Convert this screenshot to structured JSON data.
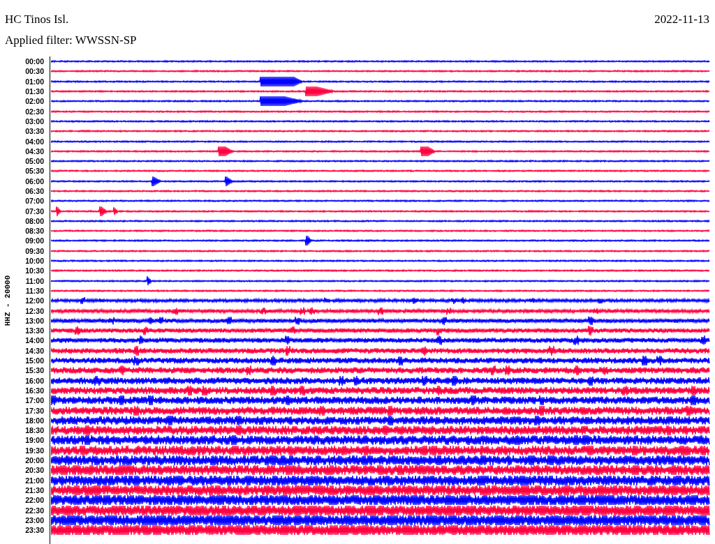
{
  "station": "HC Tinos Isl.",
  "date": "2022-11-13",
  "filter": "Applied filter: WWSSN-SP",
  "axis_label": "HHZ - 20000",
  "rows": [
    {
      "time": "00:00",
      "color": "#0000ff"
    },
    {
      "time": "00:30",
      "color": "#ff0040"
    },
    {
      "time": "01:00",
      "color": "#0000ff"
    },
    {
      "time": "01:30",
      "color": "#ff0040"
    },
    {
      "time": "02:00",
      "color": "#0000ff"
    },
    {
      "time": "02:30",
      "color": "#ff0040"
    },
    {
      "time": "03:00",
      "color": "#0000ff"
    },
    {
      "time": "03:30",
      "color": "#ff0040"
    },
    {
      "time": "04:00",
      "color": "#0000ff"
    },
    {
      "time": "04:30",
      "color": "#ff0040"
    },
    {
      "time": "05:00",
      "color": "#0000ff"
    },
    {
      "time": "05:30",
      "color": "#ff0040"
    },
    {
      "time": "06:00",
      "color": "#0000ff"
    },
    {
      "time": "06:30",
      "color": "#ff0040"
    },
    {
      "time": "07:00",
      "color": "#0000ff"
    },
    {
      "time": "07:30",
      "color": "#ff0040"
    },
    {
      "time": "08:00",
      "color": "#0000ff"
    },
    {
      "time": "08:30",
      "color": "#ff0040"
    },
    {
      "time": "09:00",
      "color": "#0000ff"
    },
    {
      "time": "09:30",
      "color": "#ff0040"
    },
    {
      "time": "10:00",
      "color": "#0000ff"
    },
    {
      "time": "10:30",
      "color": "#ff0040"
    },
    {
      "time": "11:00",
      "color": "#0000ff"
    },
    {
      "time": "11:30",
      "color": "#ff0040"
    },
    {
      "time": "12:00",
      "color": "#0000ff"
    },
    {
      "time": "12:30",
      "color": "#ff0040"
    },
    {
      "time": "13:00",
      "color": "#0000ff"
    },
    {
      "time": "13:30",
      "color": "#ff0040"
    },
    {
      "time": "14:00",
      "color": "#0000ff"
    },
    {
      "time": "14:30",
      "color": "#ff0040"
    },
    {
      "time": "15:00",
      "color": "#0000ff"
    },
    {
      "time": "15:30",
      "color": "#ff0040"
    },
    {
      "time": "16:00",
      "color": "#0000ff"
    },
    {
      "time": "16:30",
      "color": "#ff0040"
    },
    {
      "time": "17:00",
      "color": "#0000ff"
    },
    {
      "time": "17:30",
      "color": "#ff0040"
    },
    {
      "time": "18:00",
      "color": "#0000ff"
    },
    {
      "time": "18:30",
      "color": "#ff0040"
    },
    {
      "time": "19:00",
      "color": "#0000ff"
    },
    {
      "time": "19:30",
      "color": "#ff0040"
    },
    {
      "time": "20:00",
      "color": "#0000ff"
    },
    {
      "time": "20:30",
      "color": "#ff0040"
    },
    {
      "time": "21:00",
      "color": "#0000ff"
    },
    {
      "time": "21:30",
      "color": "#ff0040"
    },
    {
      "time": "22:00",
      "color": "#0000ff"
    },
    {
      "time": "22:30",
      "color": "#ff0040"
    },
    {
      "time": "23:00",
      "color": "#0000ff"
    },
    {
      "time": "23:30",
      "color": "#ff0040"
    }
  ]
}
